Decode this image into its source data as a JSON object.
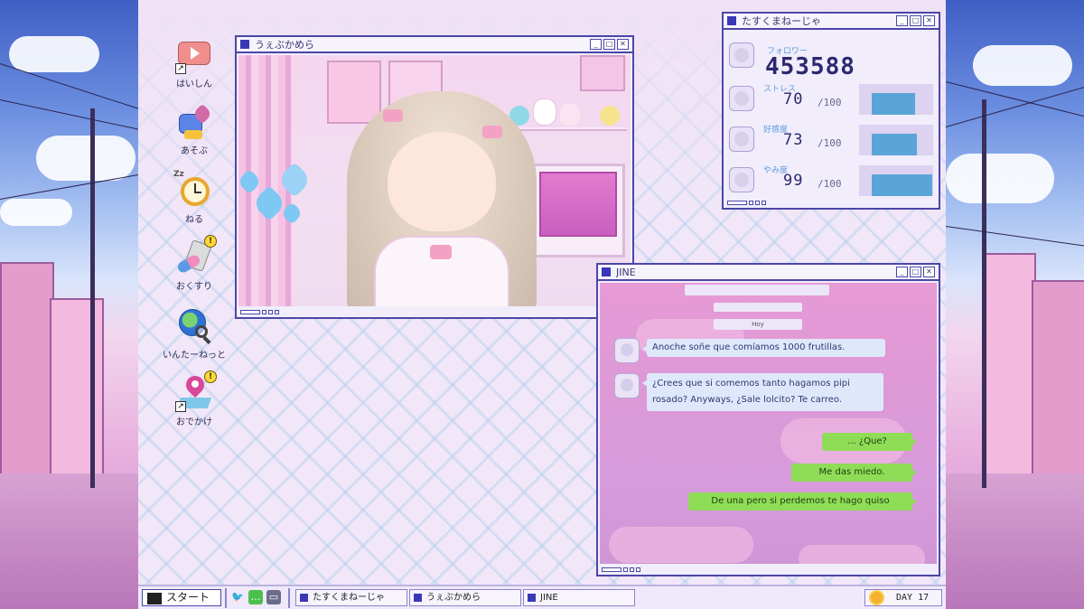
{
  "desktop_icons": [
    {
      "id": "haishin",
      "label": "はいしん",
      "icon": "video-play-icon",
      "badge": "",
      "shortcut": true
    },
    {
      "id": "asobu",
      "label": "あそぶ",
      "icon": "game-controller-heart-icon",
      "badge": "",
      "shortcut": false
    },
    {
      "id": "neru",
      "label": "ねる",
      "icon": "alarm-clock-icon",
      "badge": "Zz",
      "shortcut": false
    },
    {
      "id": "okusuri",
      "label": "おくすり",
      "icon": "pills-icon",
      "badge": "!",
      "shortcut": false
    },
    {
      "id": "internet",
      "label": "いんたーねっと",
      "icon": "globe-search-icon",
      "badge": "",
      "shortcut": false
    },
    {
      "id": "odekake",
      "label": "おでかけ",
      "icon": "map-pin-icon",
      "badge": "!",
      "shortcut": true
    }
  ],
  "stream_window": {
    "title": "うぇぶかめら"
  },
  "stats_window": {
    "title": "たすくまねーじゃ",
    "followers": {
      "label": "フォロワー",
      "value": "453588"
    },
    "stats": [
      {
        "label": "ストレス",
        "value": "70",
        "max": "/100",
        "level": 0.7
      },
      {
        "label": "好感度",
        "value": "73",
        "max": "/100",
        "level": 0.73
      },
      {
        "label": "やみ度",
        "value": "99",
        "max": "/100",
        "level": 0.99
      }
    ]
  },
  "chat_window": {
    "title": "JINE",
    "date_label": "Hoy",
    "messages_in": [
      "Anoche soñe que comíamos 1000 frutillas.",
      "¿Crees que si comemos tanto hagamos pipi rosado? Anyways, ¿Sale lolcito? Te carreo."
    ],
    "messages_in_lines": [
      [
        "Anoche soñe que comíamos 1000 frutillas."
      ],
      [
        "¿Crees que si comemos tanto hagamos pipi",
        "rosado? Anyways, ¿Sale lolcito? Te carreo."
      ]
    ],
    "messages_out": [
      "... ¿Que?",
      "Me das miedo.",
      "De una pero si perdemos te hago quiso"
    ]
  },
  "taskbar": {
    "start_label": "スタート",
    "quick_icons": [
      "twitter-bird-icon",
      "chat-bubble-icon",
      "monitor-icon"
    ],
    "tasks": [
      "たすくまねーじゃ",
      "うぇぶかめら",
      "JINE"
    ],
    "day_label": "DAY 17"
  },
  "colors": {
    "accent": "#4b46a8",
    "out_bubble": "#8fdc56",
    "in_bubble": "#dfe8fb",
    "stat_fill": "#5aa5d8"
  }
}
